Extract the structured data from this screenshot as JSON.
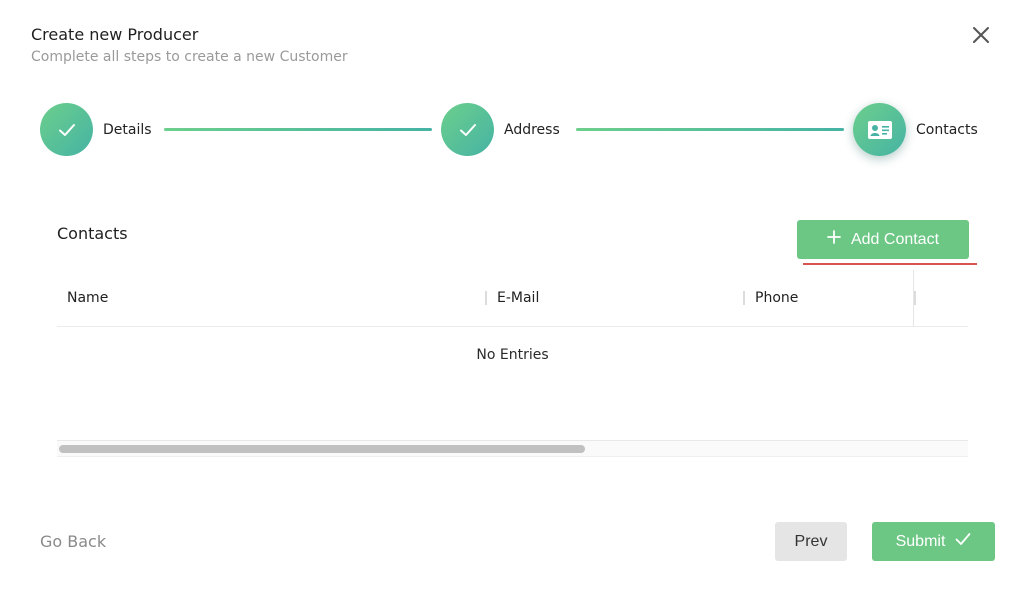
{
  "dialog": {
    "title": "Create new Producer",
    "subtitle": "Complete all steps to create a new Customer"
  },
  "stepper": {
    "steps": [
      {
        "label": "Details",
        "status": "completed",
        "icon": "check-icon"
      },
      {
        "label": "Address",
        "status": "completed",
        "icon": "check-icon"
      },
      {
        "label": "Contacts",
        "status": "active",
        "icon": "contact-card-icon"
      }
    ]
  },
  "contacts": {
    "section_title": "Contacts",
    "add_button_label": "Add Contact",
    "columns": [
      "Name",
      "E-Mail",
      "Phone"
    ],
    "rows": [],
    "empty_text": "No Entries"
  },
  "footer": {
    "go_back_label": "Go Back",
    "prev_label": "Prev",
    "submit_label": "Submit"
  },
  "colors": {
    "accent_green": "#6cc785",
    "gradient_start": "#6ccf8c",
    "gradient_end": "#46b3a4",
    "annotation_red": "#d9534f"
  }
}
